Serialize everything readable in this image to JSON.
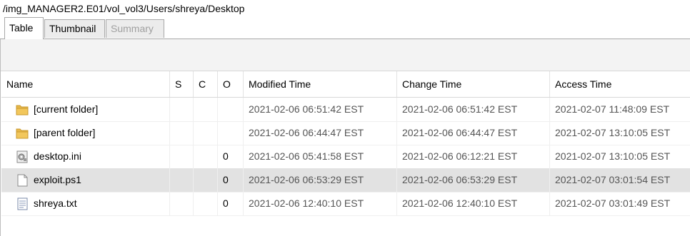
{
  "path": "/img_MANAGER2.E01/vol_vol3/Users/shreya/Desktop",
  "tabs": [
    {
      "label": "Table",
      "state": "active"
    },
    {
      "label": "Thumbnail",
      "state": "normal"
    },
    {
      "label": "Summary",
      "state": "disabled"
    }
  ],
  "columns": {
    "name": "Name",
    "s": "S",
    "c": "C",
    "o": "O",
    "modified": "Modified Time",
    "change": "Change Time",
    "access": "Access Time"
  },
  "rows": [
    {
      "icon": "folder-icon",
      "name": "[current folder]",
      "s": "",
      "c": "",
      "o": "",
      "modified": "2021-02-06 06:51:42 EST",
      "change": "2021-02-06 06:51:42 EST",
      "access": "2021-02-07 11:48:09 EST"
    },
    {
      "icon": "folder-icon",
      "name": "[parent folder]",
      "s": "",
      "c": "",
      "o": "",
      "modified": "2021-02-06 06:44:47 EST",
      "change": "2021-02-06 06:44:47 EST",
      "access": "2021-02-07 13:10:05 EST"
    },
    {
      "icon": "settings-file-icon",
      "name": "desktop.ini",
      "s": "",
      "c": "",
      "o": "0",
      "modified": "2021-02-06 05:41:58 EST",
      "change": "2021-02-06 06:12:21 EST",
      "access": "2021-02-07 13:10:05 EST"
    },
    {
      "icon": "blank-file-icon",
      "name": "exploit.ps1",
      "s": "",
      "c": "",
      "o": "0",
      "modified": "2021-02-06 06:53:29 EST",
      "change": "2021-02-06 06:53:29 EST",
      "access": "2021-02-07 03:01:54 EST",
      "selected": true
    },
    {
      "icon": "text-file-icon",
      "name": "shreya.txt",
      "s": "",
      "c": "",
      "o": "0",
      "modified": "2021-02-06 12:40:10 EST",
      "change": "2021-02-06 12:40:10 EST",
      "access": "2021-02-07 03:01:49 EST"
    }
  ],
  "colors": {
    "folder": "#e8b84a",
    "selected_row": "#e2e2e2"
  }
}
